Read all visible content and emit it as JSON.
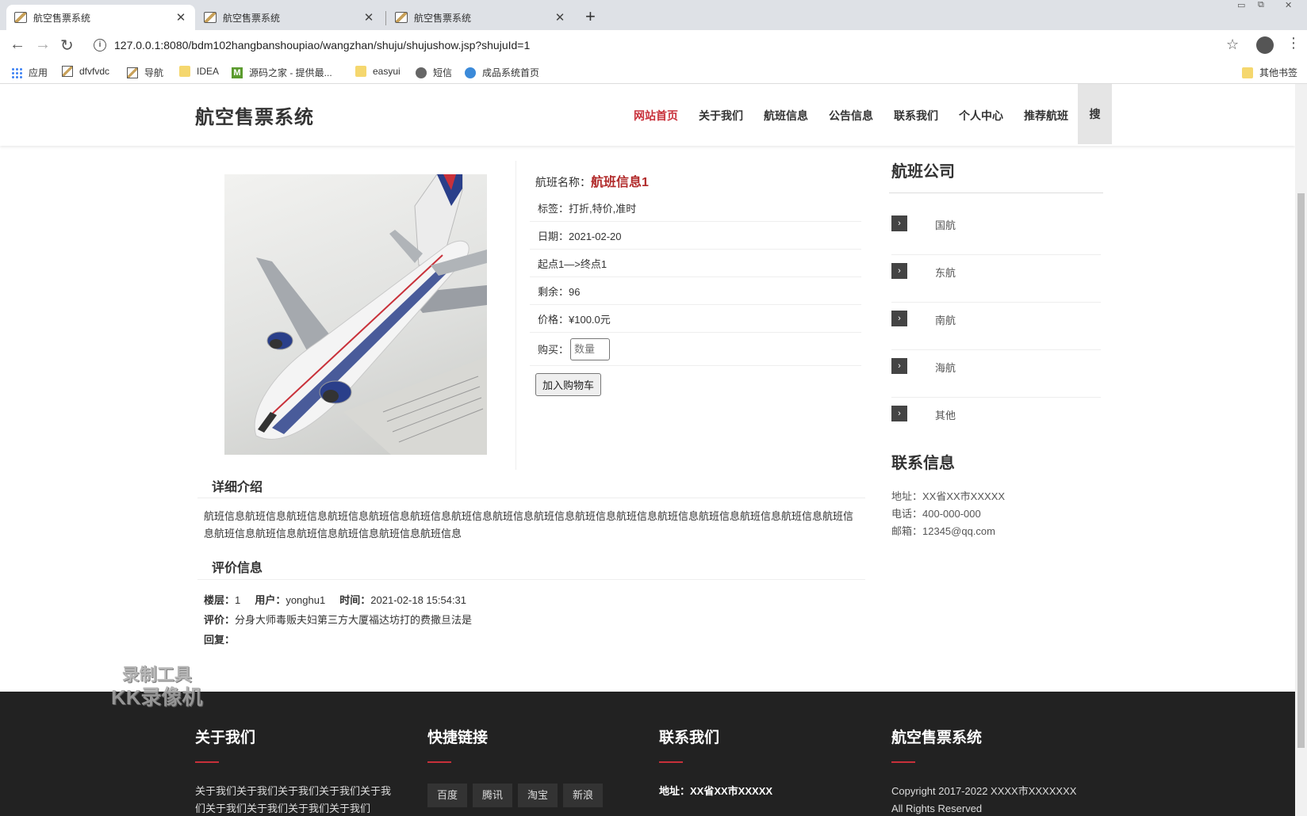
{
  "browser": {
    "tabs": [
      {
        "label": "航空售票系统",
        "close": "✕"
      },
      {
        "label": "航空售票系统",
        "close": "✕"
      },
      {
        "label": "航空售票系统",
        "close": "✕"
      }
    ],
    "new_tab": "+",
    "url": "127.0.0.1:8080/bdm102hangbanshoupiao/wangzhan/shuju/shujushow.jsp?shujuId=1",
    "bookmarks": [
      {
        "label": "应用",
        "icon": "apps-icon"
      },
      {
        "label": "dfvfvdc",
        "icon": "page-icon"
      },
      {
        "label": "导航",
        "icon": "page-icon"
      },
      {
        "label": "IDEA",
        "icon": "folder-icon"
      },
      {
        "label": "源码之家 - 提供最...",
        "icon": "m-icon"
      },
      {
        "label": "easyui",
        "icon": "folder-icon"
      },
      {
        "label": "短信",
        "icon": "globe-icon"
      },
      {
        "label": "成品系统首页",
        "icon": "globe-icon"
      }
    ],
    "other_bookmarks": "其他书签"
  },
  "site": {
    "logo": "航空售票系统",
    "nav": [
      "网站首页",
      "关于我们",
      "航班信息",
      "公告信息",
      "联系我们",
      "个人中心",
      "推荐航班"
    ],
    "search_label": "搜"
  },
  "detail": {
    "name_label": "航班名称：",
    "name_value": "航班信息1",
    "tags": "标签：打折,特价,准时",
    "date": "日期：2021-02-20",
    "route": "起点1—>终点1",
    "remaining": "剩余：96",
    "price": "价格：¥100.0元",
    "buy_label": "购买：",
    "qty_placeholder": "数量",
    "cart_button": "加入购物车"
  },
  "intro": {
    "title": "详细介绍",
    "text": "航班信息航班信息航班信息航班信息航班信息航班信息航班信息航班信息航班信息航班信息航班信息航班信息航班信息航班信息航班信息航班信息航班信息航班信息航班信息航班信息航班信息航班信息"
  },
  "reviews": {
    "title": "评价信息",
    "floor_label": "楼层：",
    "floor": "1",
    "user_label": "用户：",
    "user": "yonghu1",
    "time_label": "时间：",
    "time": "2021-02-18 15:54:31",
    "comment_label": "评价：",
    "comment": "分身大师毒贩夫妇第三方大厦福达坊打的费撒旦法是",
    "reply_label": "回复："
  },
  "sidebar": {
    "companies_title": "航班公司",
    "companies": [
      "国航",
      "东航",
      "南航",
      "海航",
      "其他"
    ],
    "contact_title": "联系信息",
    "address": "地址：XX省XX市XXXXX",
    "phone": "电话：400-000-000",
    "email": "邮箱：12345@qq.com"
  },
  "footer": {
    "about_title": "关于我们",
    "about_text": "关于我们关于我们关于我们关于我们关于我们关于我们关于我们关于我们关于我们",
    "links_title": "快捷链接",
    "links": [
      "百度",
      "腾讯",
      "淘宝",
      "新浪"
    ],
    "contact_title": "联系我们",
    "contact_address": "地址：XX省XX市XXXXX",
    "brand_title": "航空售票系统",
    "copyright": "Copyright 2017-2022 XXXX市XXXXXXX All Rights Reserved"
  },
  "watermark": {
    "line1": "录制工具",
    "line2": "KK录像机"
  }
}
